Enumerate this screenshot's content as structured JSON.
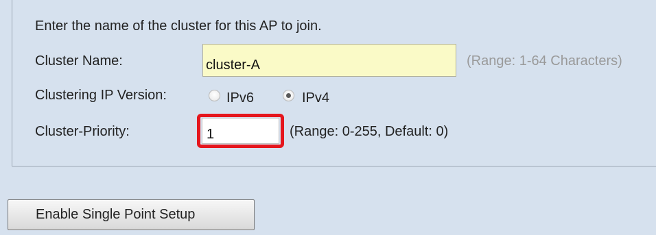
{
  "cluster_settings": {
    "instruction": "Enter the name of the cluster for this AP to join.",
    "cluster_name": {
      "label": "Cluster Name:",
      "value": "cluster-A",
      "hint": "(Range: 1-64 Characters)"
    },
    "ip_version": {
      "label": "Clustering IP Version:",
      "options": [
        {
          "label": "IPv6",
          "selected": false
        },
        {
          "label": "IPv4",
          "selected": true
        }
      ]
    },
    "cluster_priority": {
      "label": "Cluster-Priority:",
      "value": "1",
      "hint": "(Range: 0-255, Default: 0)",
      "highlight_color": "#e5161d"
    }
  },
  "actions": {
    "single_point_setup_label": "Enable Single Point Setup"
  },
  "colors": {
    "background": "#d6e1ee",
    "name_field_bg": "#fafac7"
  }
}
